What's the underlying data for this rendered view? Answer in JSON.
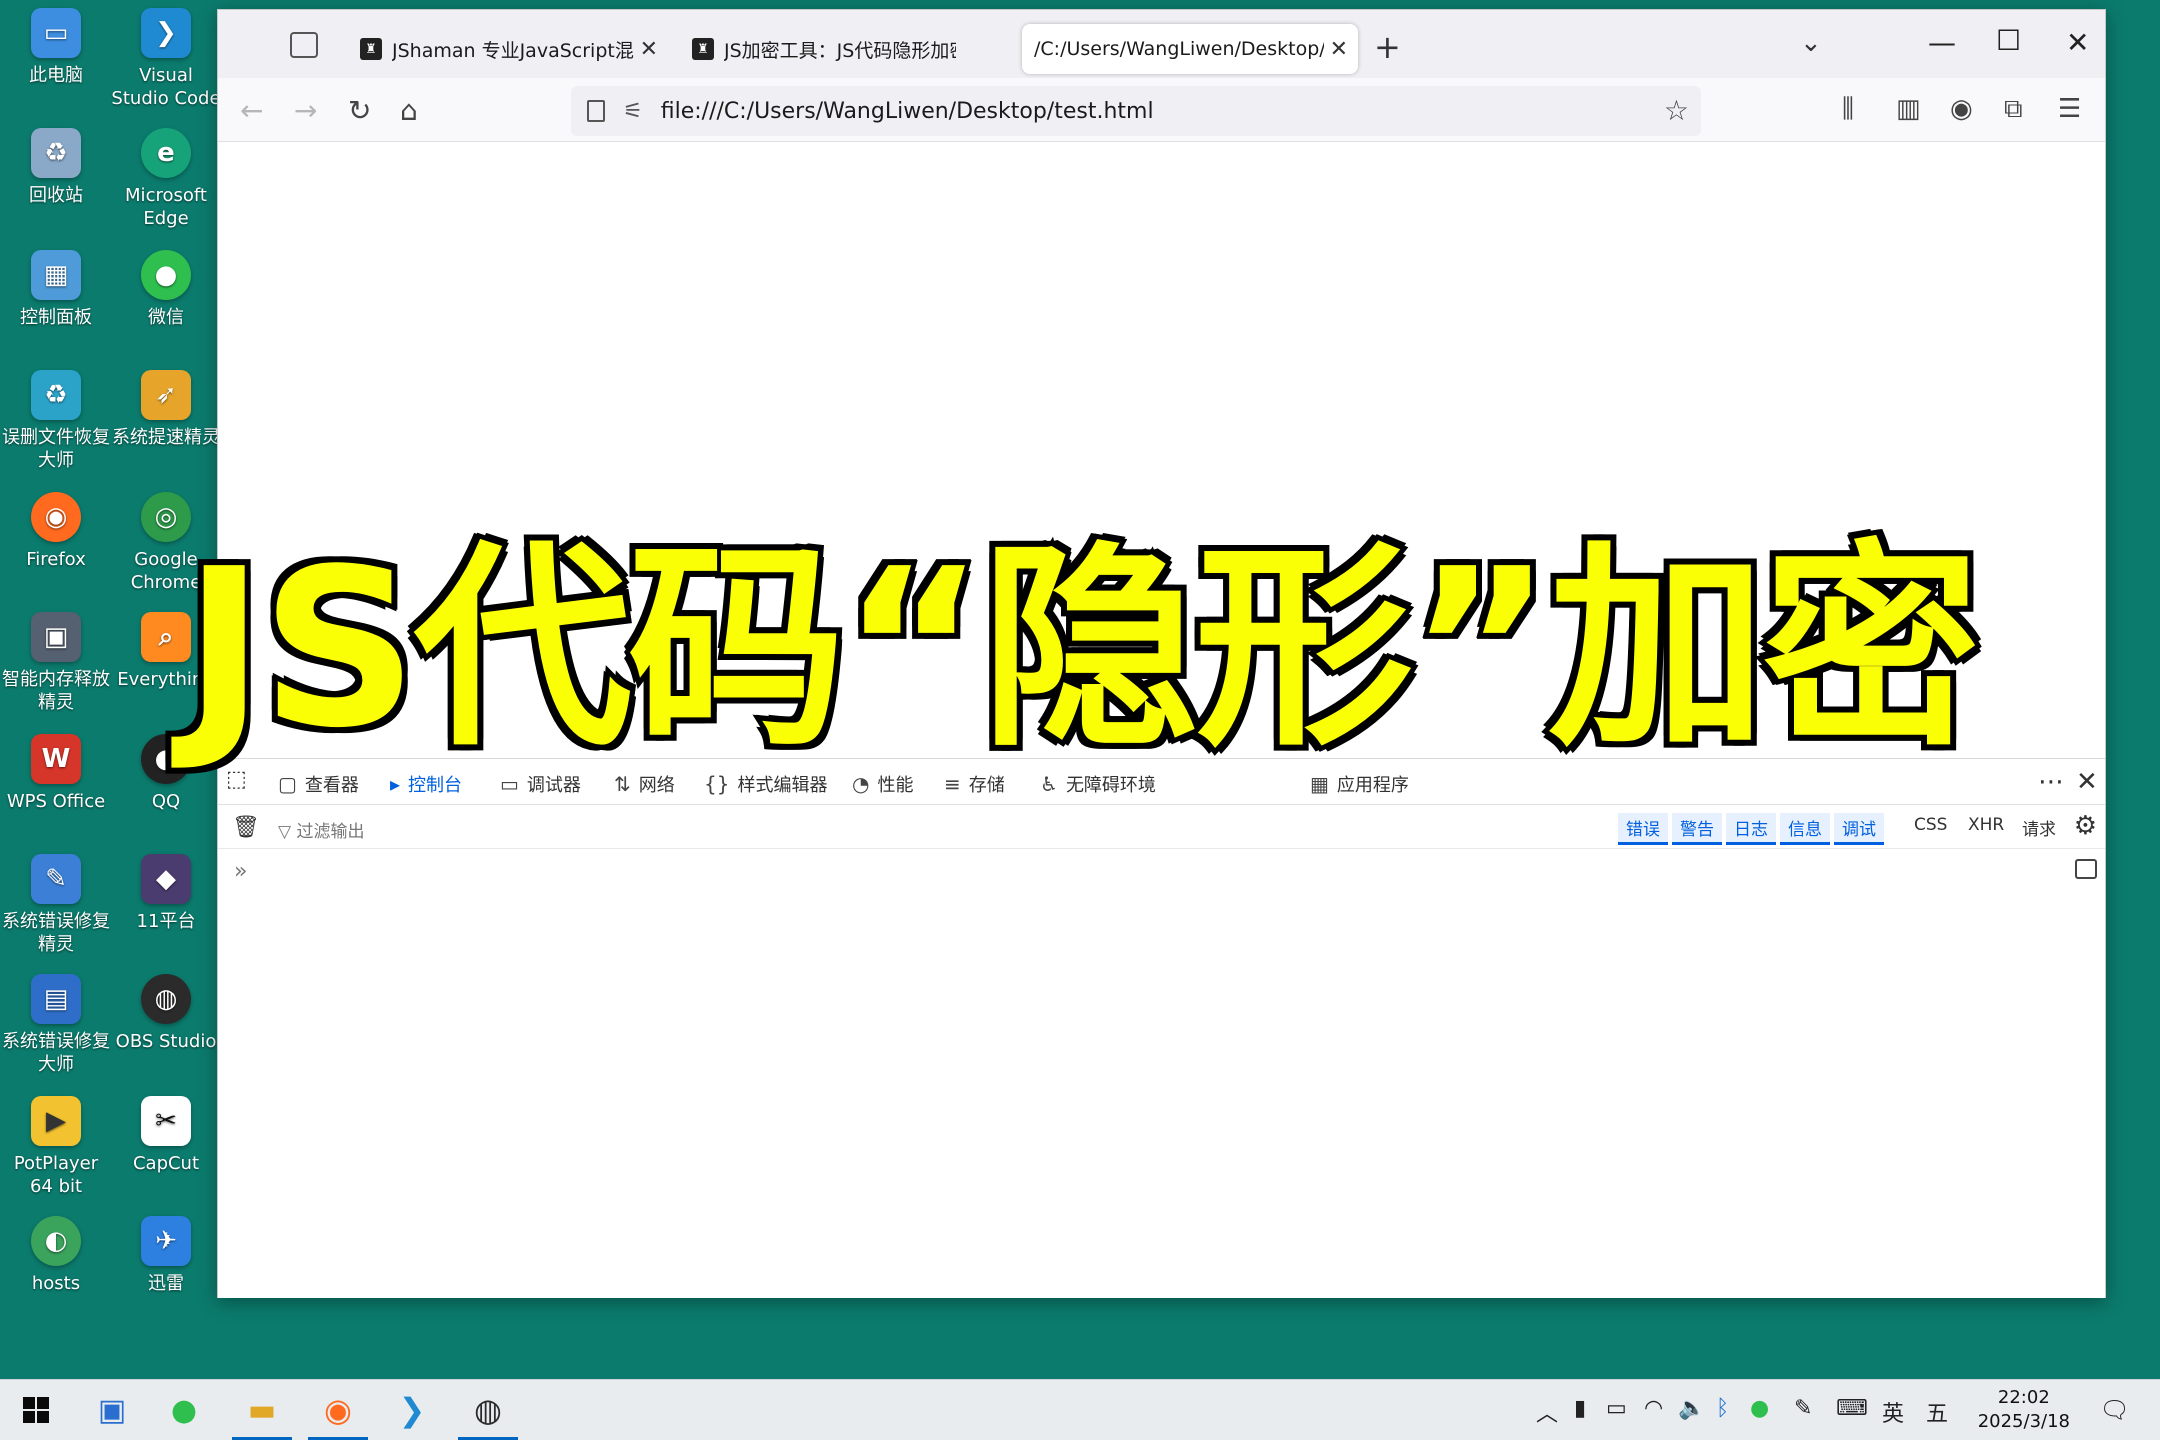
{
  "desktop": {
    "icons": [
      {
        "label": "此电脑",
        "icon": "computer-icon",
        "color": "#3d8ee0"
      },
      {
        "label": "Visual\nStudio Code",
        "icon": "vscode-icon",
        "color": "#1f8ad2"
      },
      {
        "label": "回收站",
        "icon": "recycle-bin-icon",
        "color": "#8aa8c8"
      },
      {
        "label": "Microsoft\nEdge",
        "icon": "edge-icon",
        "color": "#17a37a"
      },
      {
        "label": "控制面板",
        "icon": "control-panel-icon",
        "color": "#4f9bd9"
      },
      {
        "label": "微信",
        "icon": "wechat-icon",
        "color": "#2fbf4f"
      },
      {
        "label": "误删文件恢复\n大师",
        "icon": "file-recovery-icon",
        "color": "#2ba3c9"
      },
      {
        "label": "系统提速精灵",
        "icon": "speedup-icon",
        "color": "#e6a52a"
      },
      {
        "label": "Firefox",
        "icon": "firefox-icon",
        "color": "#ff6a1f"
      },
      {
        "label": "Google\nChrome",
        "icon": "chrome-icon",
        "color": "#2e9b4a"
      },
      {
        "label": "智能内存释放\n精灵",
        "icon": "memory-icon",
        "color": "#556070"
      },
      {
        "label": "Everything",
        "icon": "everything-icon",
        "color": "#ff8a1f"
      },
      {
        "label": "WPS Office",
        "icon": "wps-icon",
        "color": "#d6352a"
      },
      {
        "label": "QQ",
        "icon": "qq-icon",
        "color": "#222222"
      },
      {
        "label": "系统错误修复\n精灵",
        "icon": "repair-tool-icon",
        "color": "#3c7fd6"
      },
      {
        "label": "11平台",
        "icon": "game-platform-icon",
        "color": "#4a3c6e"
      },
      {
        "label": "系统错误修复\n大师",
        "icon": "repair-master-icon",
        "color": "#2f6ec8"
      },
      {
        "label": "OBS Studio",
        "icon": "obs-icon",
        "color": "#2b2b2b"
      },
      {
        "label": "PotPlayer\n64 bit",
        "icon": "potplayer-icon",
        "color": "#f2c230"
      },
      {
        "label": "CapCut",
        "icon": "capcut-icon",
        "color": "#111111"
      },
      {
        "label": "hosts",
        "icon": "hosts-icon",
        "color": "#3aa35c"
      },
      {
        "label": "迅雷",
        "icon": "thunder-icon",
        "color": "#2d7fe0"
      }
    ]
  },
  "browser": {
    "tabs": [
      {
        "title": "JShaman 专业JavaScript混淆加",
        "close": "✕"
      },
      {
        "title": "JS加密工具：JS代码隐形加密",
        "close": "✕"
      },
      {
        "title": "/C:/Users/WangLiwen/Desktop/te",
        "close": "✕"
      }
    ],
    "new_tab": "+",
    "url": "file:///C:/Users/WangLiwen/Desktop/test.html"
  },
  "devtools": {
    "tabs": [
      {
        "label": "查看器",
        "icon": "inspector-icon"
      },
      {
        "label": "控制台",
        "icon": "console-icon"
      },
      {
        "label": "调试器",
        "icon": "debugger-icon"
      },
      {
        "label": "网络",
        "icon": "network-icon"
      },
      {
        "label": "样式编辑器",
        "icon": "style-editor-icon"
      },
      {
        "label": "性能",
        "icon": "performance-icon"
      },
      {
        "label": "存储",
        "icon": "storage-icon"
      },
      {
        "label": "无障碍环境",
        "icon": "accessibility-icon"
      },
      {
        "label": "应用程序",
        "icon": "application-icon"
      }
    ],
    "filter_placeholder": "过滤输出",
    "filters_active": [
      "错误",
      "警告",
      "日志",
      "信息",
      "调试"
    ],
    "filters_plain": [
      "CSS",
      "XHR",
      "请求"
    ],
    "prompt": "»"
  },
  "caption": "JS代码“隐形”加密",
  "caption_color": "#fbff05",
  "taskbar": {
    "apps": [
      {
        "name": "start-button",
        "icon": "windows-icon"
      },
      {
        "name": "computer-manager",
        "icon": "computer-manager-icon"
      },
      {
        "name": "wechat",
        "icon": "wechat-icon"
      },
      {
        "name": "file-explorer",
        "icon": "folder-icon"
      },
      {
        "name": "firefox",
        "icon": "firefox-icon"
      },
      {
        "name": "vscode",
        "icon": "vscode-icon"
      },
      {
        "name": "obs",
        "icon": "obs-icon"
      }
    ],
    "ime_lang": "英",
    "ime_mode": "五",
    "time": "22:02",
    "date": "2025/3/18"
  }
}
